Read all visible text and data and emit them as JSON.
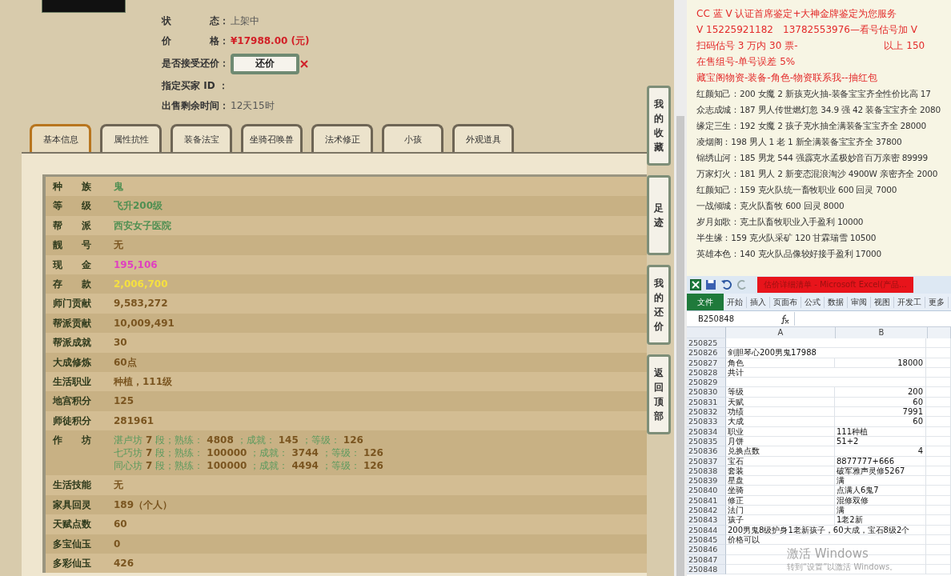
{
  "info": [
    {
      "kind": "text",
      "label": "状　　　　态：",
      "value": "上架中"
    },
    {
      "kind": "price",
      "label": "价　　　　格：",
      "value": "¥17988.00 (元)"
    },
    {
      "kind": "button",
      "label": "是否接受还价：",
      "button": "还价"
    },
    {
      "kind": "text",
      "label": "指定买家 ID ："
    },
    {
      "kind": "text",
      "label": "出售剩余时间：",
      "value": "12天15时"
    }
  ],
  "tabs": [
    {
      "label": "基本信息",
      "selected": true
    },
    {
      "label": "属性抗性",
      "selected": false
    },
    {
      "label": "装备法宝",
      "selected": false
    },
    {
      "label": "坐骑召唤兽",
      "selected": false
    },
    {
      "label": "法术修正",
      "selected": false
    },
    {
      "label": "小孩",
      "selected": false
    },
    {
      "label": "外观道具",
      "selected": false
    }
  ],
  "table": [
    {
      "label": "种　　族",
      "value": "鬼",
      "color": "#4f8f52"
    },
    {
      "label": "等　　级",
      "value": "飞升200级",
      "color": "#4f8f52"
    },
    {
      "label": "帮　　派",
      "value": "西安女子医院",
      "color": "#4f8f52"
    },
    {
      "label": "靓　　号",
      "value": "无",
      "color": "#7a5520"
    },
    {
      "label": "现　　金",
      "value": "195,106",
      "color": "#e040c0"
    },
    {
      "label": "存　　款",
      "value": "2,006,700",
      "color": "#f5e040"
    },
    {
      "label": "师门贡献",
      "value": "9,583,272",
      "color": "#7a5520"
    },
    {
      "label": "帮派贡献",
      "value": "10,009,491",
      "color": "#7a5520"
    },
    {
      "label": "帮派成就",
      "value": "30",
      "color": "#7a5520"
    },
    {
      "label": "大成修炼",
      "value": "60点",
      "color": "#7a5520"
    },
    {
      "label": "生活职业",
      "value": "种植，111级",
      "color": "#7a5520"
    },
    {
      "label": "地宫积分",
      "value": "125",
      "color": "#7a5520"
    },
    {
      "label": "师徒积分",
      "value": "281961",
      "color": "#7a5520"
    },
    {
      "label": "作　　坊",
      "lines": [
        [
          {
            "kind": "label",
            "text": "湛卢坊"
          },
          {
            "kind": "num",
            "text": "7"
          },
          {
            "kind": "label",
            "text": "段；熟练："
          },
          {
            "kind": "num",
            "text": "4808"
          },
          {
            "kind": "label",
            "text": "；成就："
          },
          {
            "kind": "num",
            "text": "145"
          },
          {
            "kind": "label",
            "text": "；等级："
          },
          {
            "kind": "num",
            "text": "126"
          }
        ],
        [
          {
            "kind": "label",
            "text": "七巧坊"
          },
          {
            "kind": "num",
            "text": "7"
          },
          {
            "kind": "label",
            "text": "段；熟练："
          },
          {
            "kind": "num",
            "text": "100000"
          },
          {
            "kind": "label",
            "text": "；成就："
          },
          {
            "kind": "num",
            "text": "3744"
          },
          {
            "kind": "label",
            "text": "；等级："
          },
          {
            "kind": "num",
            "text": "126"
          }
        ],
        [
          {
            "kind": "label",
            "text": "同心坊"
          },
          {
            "kind": "num",
            "text": "7"
          },
          {
            "kind": "label",
            "text": "段；熟练："
          },
          {
            "kind": "num",
            "text": "100000"
          },
          {
            "kind": "label",
            "text": "；成就："
          },
          {
            "kind": "num",
            "text": "4494"
          },
          {
            "kind": "label",
            "text": "；等级："
          },
          {
            "kind": "num",
            "text": "126"
          }
        ]
      ]
    },
    {
      "label": "生活技能",
      "value": "无",
      "color": "#7a5520"
    },
    {
      "label": "家具回灵",
      "value": "189（个人）",
      "color": "#7a5520"
    },
    {
      "label": "天赋点数",
      "value": "60",
      "color": "#7a5520"
    },
    {
      "label": "多宝仙玉",
      "value": "0",
      "color": "#7a5520"
    },
    {
      "label": "多彩仙玉",
      "value": "426",
      "color": "#7a5520"
    }
  ],
  "side_buttons": [
    "我的收藏",
    "足迹",
    "我的还价",
    "返回顶部"
  ],
  "notes": [
    {
      "kind": "headline",
      "text": "CC 蓝 V 认证首席鉴定+大神金牌鉴定为您服务"
    },
    {
      "kind": "headline",
      "text": "V 15225921182　13782553976—看号估号加 V"
    },
    {
      "kind": "headline",
      "text": "扫码估号 3 万内 30 票-　　　　　　　　　以上 150"
    },
    {
      "kind": "headline",
      "text": "在售组号-单号误差 5%"
    },
    {
      "kind": "headline",
      "text": "藏宝阁物资-装备-角色-物资联系我--抽红包"
    },
    {
      "kind": "plain",
      "text": "红颜知己：200 女魔 2 新孩克火抽-装备宝宝齐全性价比高 17"
    },
    {
      "kind": "plain",
      "text": "众志成城：187 男人传世燃灯忽 34.9 强 42 装备宝宝齐全 2080"
    },
    {
      "kind": "plain",
      "text": "缘定三生：192 女魔 2 孩子克水抽全满装备宝宝齐全 28000"
    },
    {
      "kind": "plain",
      "text": "凌烟阁：198 男人 1 老 1 新全满装备宝宝齐全 37800"
    },
    {
      "kind": "plain",
      "text": "锦绣山河：185 男龙 544 强霹克水孟极妙音百万亲密 89999"
    },
    {
      "kind": "plain",
      "text": "万家灯火：181 男人 2 新变态混浪淘沙 4900W 亲密齐全 2000"
    },
    {
      "kind": "plain",
      "text": "红颜知己：159 克火队统一畜牧职业 600 回灵 7000"
    },
    {
      "kind": "plain",
      "text": "一战倾城：克火队畜牧 600 回灵 8000"
    },
    {
      "kind": "plain",
      "text": "岁月如歌：克土队畜牧职业入手盈利 10000"
    },
    {
      "kind": "plain",
      "text": "半生缘：159 克火队采矿 120 甘霖瑞雪 10500"
    },
    {
      "kind": "plain",
      "text": "英雄本色：140 克火队品像较好接手盈利 17000"
    }
  ],
  "excel": {
    "title": "估价详细清单 - Microsoft Excel(产品...",
    "ribbon": [
      {
        "label": "文件",
        "kind": "file"
      },
      {
        "label": "开始",
        "kind": "tab"
      },
      {
        "label": "插入",
        "kind": "tab"
      },
      {
        "label": "页面布",
        "kind": "tab"
      },
      {
        "label": "公式",
        "kind": "tab"
      },
      {
        "label": "数据",
        "kind": "tab"
      },
      {
        "label": "审阅",
        "kind": "tab"
      },
      {
        "label": "视图",
        "kind": "tab"
      },
      {
        "label": "开发工",
        "kind": "tab"
      },
      {
        "label": "更多",
        "kind": "tab"
      }
    ],
    "name_box": "B250848",
    "columns": [
      "A",
      "B"
    ],
    "rows": [
      {
        "num": "250825"
      },
      {
        "num": "250826",
        "a": "剑胆琴心200男鬼17988"
      },
      {
        "num": "250827",
        "a": "角色",
        "b": "18000",
        "b_numeric": true
      },
      {
        "num": "250828",
        "a": "共计"
      },
      {
        "num": "250829"
      },
      {
        "num": "250830",
        "a": "等级",
        "b": "200",
        "b_numeric": true
      },
      {
        "num": "250831",
        "a": "天赋",
        "b": "60",
        "b_numeric": true
      },
      {
        "num": "250832",
        "a": "功绩",
        "b": "7991",
        "b_numeric": true
      },
      {
        "num": "250833",
        "a": "大成",
        "b": "60",
        "b_numeric": true
      },
      {
        "num": "250834",
        "a": "职业",
        "b": "111种植",
        "b_numeric": false
      },
      {
        "num": "250835",
        "a": "月饼",
        "b": "51+2",
        "b_numeric": false
      },
      {
        "num": "250836",
        "a": "兑换点数",
        "b": "4",
        "b_numeric": true
      },
      {
        "num": "250837",
        "a": "宝石",
        "b": "8877777+666",
        "b_numeric": false
      },
      {
        "num": "250838",
        "a": "套装",
        "b": "破军雅声灵修5267",
        "b_numeric": false
      },
      {
        "num": "250839",
        "a": "星盘",
        "b": "满",
        "b_numeric": false
      },
      {
        "num": "250840",
        "a": "坐骑",
        "b": "点满人6鬼7",
        "b_numeric": false
      },
      {
        "num": "250841",
        "a": "修正",
        "b": "混修双修",
        "b_numeric": false
      },
      {
        "num": "250842",
        "a": "法门",
        "b": "满",
        "b_numeric": false
      },
      {
        "num": "250843",
        "a": "孩子",
        "b": "1老2新",
        "b_numeric": false
      },
      {
        "num": "250844",
        "a": "200男鬼8级护身1老新孩子，60大成，宝石8级2个"
      },
      {
        "num": "250845",
        "a": "价格可以"
      },
      {
        "num": "250846"
      },
      {
        "num": "250847"
      },
      {
        "num": "250848"
      }
    ]
  },
  "activation": {
    "title": "激活 Windows",
    "hint": "转到“设置”以激活 Windows。"
  }
}
